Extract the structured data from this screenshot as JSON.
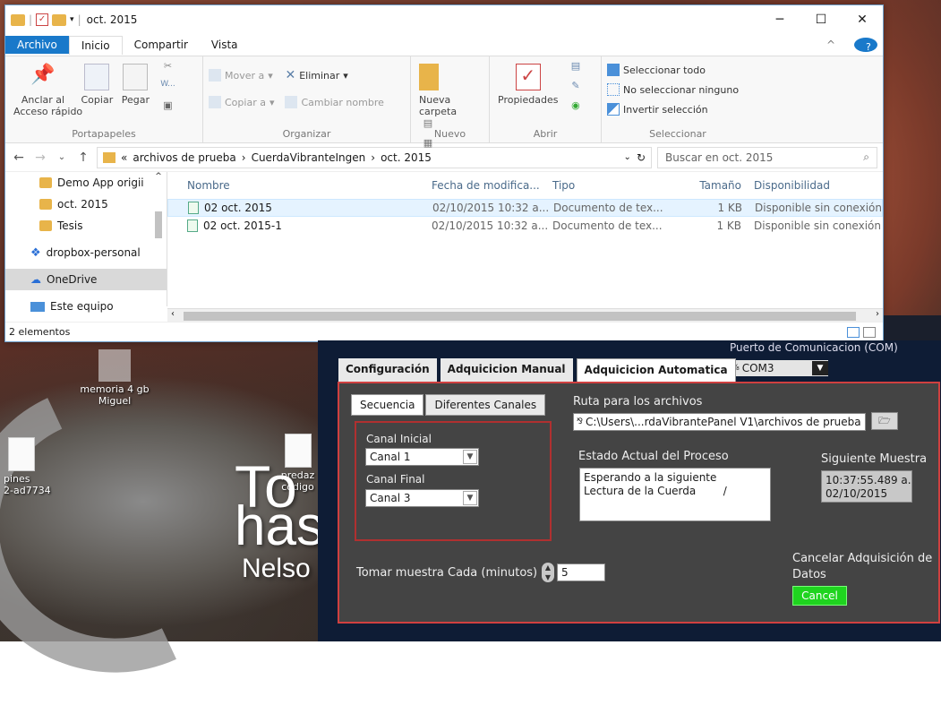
{
  "desktop": {
    "icons": [
      {
        "label": "memoria 4 gb\nMiguel"
      },
      {
        "label": "pines\n2-ad7734"
      },
      {
        "label": "predaz\ncodigo"
      }
    ],
    "wallpaper_text": {
      "line1": "To",
      "line2": "has",
      "line3": "Nelso"
    }
  },
  "explorer": {
    "title": "oct. 2015",
    "ribbon_tabs": [
      "Archivo",
      "Inicio",
      "Compartir",
      "Vista"
    ],
    "ribbon": {
      "portapapeles": {
        "pin": "Anclar al\nAcceso rápido",
        "copiar": "Copiar",
        "pegar": "Pegar",
        "label": "Portapapeles"
      },
      "organizar": {
        "mover": "Mover a",
        "copiar_a": "Copiar a",
        "eliminar": "Eliminar",
        "cambiar": "Cambiar nombre",
        "label": "Organizar"
      },
      "nuevo": {
        "carpeta": "Nueva\ncarpeta",
        "label": "Nuevo"
      },
      "abrir": {
        "propiedades": "Propiedades",
        "label": "Abrir"
      },
      "seleccionar": {
        "todo": "Seleccionar todo",
        "ninguno": "No seleccionar ninguno",
        "invertir": "Invertir selección",
        "label": "Seleccionar"
      }
    },
    "address": {
      "prefix": "«",
      "crumbs": [
        "archivos de prueba",
        "CuerdaVibranteIngen",
        "oct. 2015"
      ]
    },
    "search_placeholder": "Buscar en oct. 2015",
    "nav_items": [
      "Demo App origii",
      "oct. 2015",
      "Tesis",
      "dropbox-personal",
      "OneDrive",
      "Este equipo"
    ],
    "columns": [
      "Nombre",
      "Fecha de modifica...",
      "Tipo",
      "Tamaño",
      "Disponibilidad"
    ],
    "files": [
      {
        "name": "02 oct. 2015",
        "date": "02/10/2015 10:32 a...",
        "type": "Documento de tex...",
        "size": "1 KB",
        "avail": "Disponible sin conexión"
      },
      {
        "name": "02 oct. 2015-1",
        "date": "02/10/2015 10:32 a...",
        "type": "Documento de tex...",
        "size": "1 KB",
        "avail": "Disponible sin conexión"
      }
    ],
    "status": "2 elementos"
  },
  "lv": {
    "com_label": "Puerto de Comunicacion (COM)",
    "com_value": "COM3",
    "tabs": [
      "Configuración",
      "Adquicicion Manual",
      "Adquicicion Automatica"
    ],
    "subtabs": [
      "Secuencia",
      "Diferentes Canales"
    ],
    "canal_inicial_label": "Canal Inicial",
    "canal_inicial": "Canal 1",
    "canal_final_label": "Canal Final",
    "canal_final": "Canal 3",
    "ruta_label": "Ruta para los archivos",
    "ruta": "C:\\Users\\...rdaVibrantePanel V1\\archivos de prueba",
    "estado_label": "Estado Actual del Proceso",
    "estado": "Esperando a la siguiente\nLectura de la Cuerda        /",
    "siguiente_label": "Siguiente Muestra",
    "siguiente": "10:37:55.489 a. m.\n02/10/2015",
    "tomar_label": "Tomar muestra Cada (minutos)",
    "tomar_value": "5",
    "cancelar_label": "Cancelar Adquisición de Datos",
    "cancel_button": "Cancel"
  }
}
